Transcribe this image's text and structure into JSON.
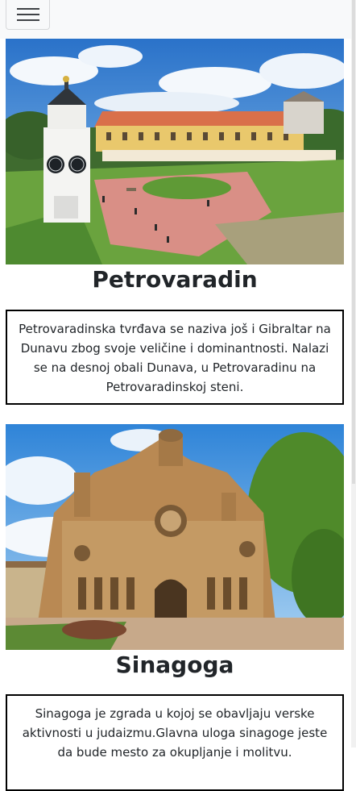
{
  "navbar": {
    "toggler_icon": "hamburger-icon"
  },
  "sections": [
    {
      "title": "Petrovaradin",
      "description": "Petrovaradinska tvrđava se naziva još i Gibraltar na Dunavu zbog svoje veličine i dominantnosti. Nalazi se na desnoj obali Dunava, u Petrovaradinu na Petrovaradinskoj steni."
    },
    {
      "title": "Sinagoga",
      "description": "Sinagoga je zgrada u kojoj se obavljaju verske aktivnosti u judaizmu.Glavna uloga sinagoge jeste da bude mesto za okupljanje i molitvu."
    }
  ]
}
